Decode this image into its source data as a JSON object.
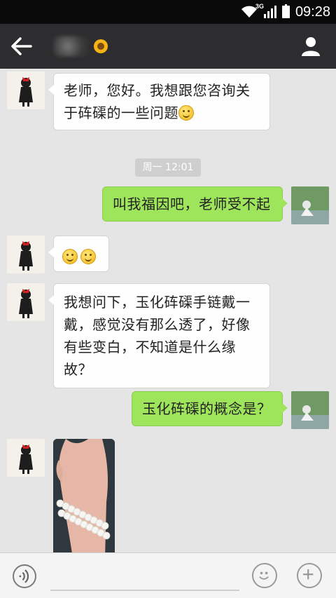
{
  "status_bar": {
    "network": "3G",
    "time": "09:28"
  },
  "header": {
    "contact_name": ""
  },
  "messages": [
    {
      "side": "in",
      "text": "老师，您好。我想跟您咨询关于砗磲的一些问题"
    },
    {
      "side": "out",
      "text": "叫我福因吧，老师受不起"
    },
    {
      "side": "in",
      "text": ""
    },
    {
      "side": "in",
      "text": "我想问下，玉化砗磲手链戴一戴，感觉没有那么透了，好像有些变白，不知道是什么缘故？"
    },
    {
      "side": "out",
      "text": "玉化砗磲的概念是？"
    }
  ],
  "timestamp": "周一 12:01",
  "input": {
    "value": "",
    "placeholder": ""
  },
  "icons": {
    "back": "arrow-left-icon",
    "profile": "person-icon",
    "voice": "voice-icon",
    "emoji": "smiley-icon",
    "more": "plus-icon"
  },
  "colors": {
    "header_bg": "#2d2d2f",
    "chat_bg": "#e5e5e5",
    "outgoing_bubble": "#9fe55b",
    "incoming_bubble": "#fefefe"
  }
}
